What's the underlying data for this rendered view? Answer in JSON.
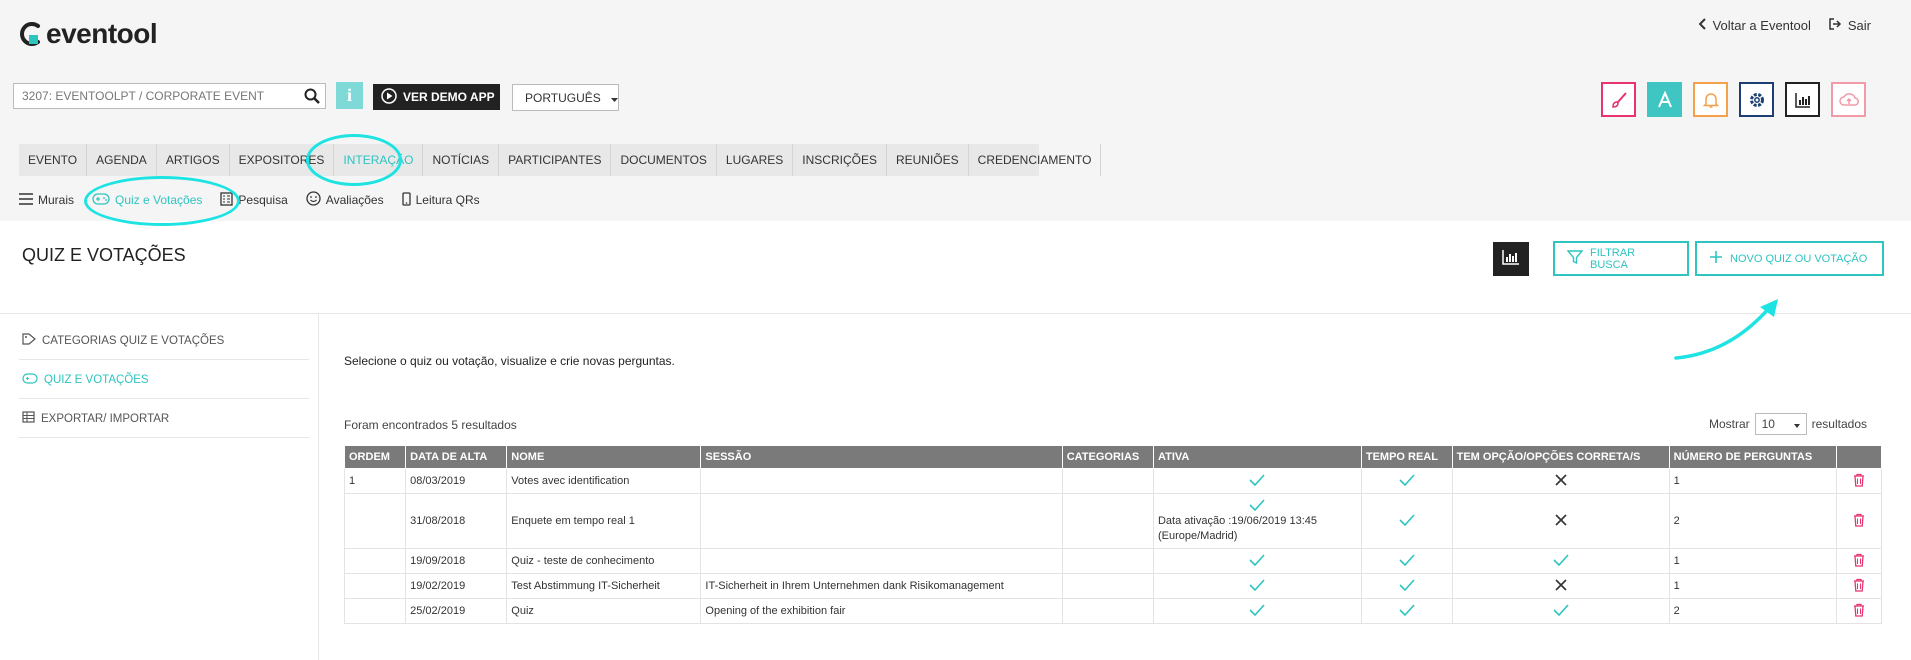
{
  "app": {
    "logo_text": "eventool"
  },
  "toplinks": {
    "back": "Voltar a Eventool",
    "exit": "Sair"
  },
  "event_selector": {
    "value": "3207: EVENTOOLPT / CORPORATE EVENT"
  },
  "buttons": {
    "info": "i",
    "demo": "VER DEMO APP",
    "language": "PORTUGUÊS",
    "filter": "FILTRAR BUSCA",
    "new_quiz": "NOVO QUIZ OU VOTAÇÃO"
  },
  "tool_icons": [
    {
      "name": "brush-icon",
      "color": "#e8336e"
    },
    {
      "name": "font-icon",
      "color": "#3fc6c2"
    },
    {
      "name": "bell-icon",
      "color": "#f5a04a"
    },
    {
      "name": "gear-icon",
      "color": "#1c3f73"
    },
    {
      "name": "chart-icon",
      "color": "#222222"
    },
    {
      "name": "cloud-upload-icon",
      "color": "#f29aa8"
    }
  ],
  "main_nav": [
    "EVENTO",
    "AGENDA",
    "ARTIGOS",
    "EXPOSITORES",
    "INTERAÇÃO",
    "NOTÍCIAS",
    "PARTICIPANTES",
    "DOCUMENTOS",
    "LUGARES",
    "INSCRIÇÕES",
    "REUNIÕES",
    "CREDENCIAMENTO"
  ],
  "main_nav_active": "INTERAÇÃO",
  "sub_nav": [
    "Murais",
    "Quiz e Votações",
    "Pesquisa",
    "Avaliações",
    "Leitura QRs"
  ],
  "page": {
    "title": "QUIZ E VOTAÇÕES"
  },
  "sidebar": [
    "CATEGORIAS QUIZ E VOTAÇÕES",
    "QUIZ E VOTAÇÕES",
    "EXPORTAR/ IMPORTAR"
  ],
  "content": {
    "intro": "Selecione o quiz ou votação, visualize e crie novas perguntas.",
    "found": "Foram encontrados 5 resultados",
    "show_label": "Mostrar",
    "show_value": "10",
    "show_suffix": "resultados"
  },
  "table": {
    "headers": [
      "ORDEM",
      "DATA DE ALTA",
      "NOME",
      "SESSÃO",
      "CATEGORIAS",
      "ATIVA",
      "TEMPO REAL",
      "TEM OPÇÃO/OPÇÕES CORRETA/S",
      "NÚMERO DE PERGUNTAS",
      ""
    ],
    "rows": [
      {
        "ordem": "1",
        "data": "08/03/2019",
        "nome": "Votes avec identification",
        "sessao": "",
        "categorias": "",
        "ativa": true,
        "ativa_note": "",
        "tempo_real": true,
        "correta": false,
        "num": "1"
      },
      {
        "ordem": "",
        "data": "31/08/2018",
        "nome": "Enquete em tempo real 1",
        "sessao": "",
        "categorias": "",
        "ativa": true,
        "ativa_note": "Data ativação :19/06/2019 13:45 (Europe/Madrid)",
        "tempo_real": true,
        "correta": false,
        "num": "2"
      },
      {
        "ordem": "",
        "data": "19/09/2018",
        "nome": "Quiz - teste de conhecimento",
        "sessao": "",
        "categorias": "",
        "ativa": true,
        "ativa_note": "",
        "tempo_real": true,
        "correta": true,
        "num": "1"
      },
      {
        "ordem": "",
        "data": "19/02/2019",
        "nome": "Test Abstimmung IT-Sicherheit",
        "sessao": "IT-Sicherheit in Ihrem Unternehmen dank Risikomanagement",
        "categorias": "",
        "ativa": true,
        "ativa_note": "",
        "tempo_real": true,
        "correta": false,
        "num": "1"
      },
      {
        "ordem": "",
        "data": "25/02/2019",
        "nome": "Quiz",
        "sessao": "Opening of the exhibition fair",
        "categorias": "",
        "ativa": true,
        "ativa_note": "",
        "tempo_real": true,
        "correta": true,
        "num": "2"
      }
    ]
  },
  "colors": {
    "accent": "#2ec4c0",
    "highlight": "#1ee3e3",
    "delete": "#e8336e",
    "header_bg": "#7a7a7a"
  }
}
